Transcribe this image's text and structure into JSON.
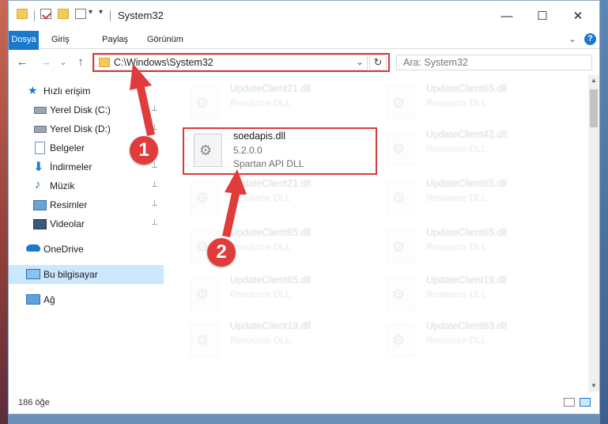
{
  "window": {
    "title": "System32",
    "controls": {
      "minimize": "—",
      "maximize": "☐",
      "close": "✕"
    }
  },
  "ribbon": {
    "tabs": [
      "Dosya",
      "Giriş",
      "Paylaş",
      "Görünüm"
    ],
    "help_icon": "?",
    "expand_icon": "⌄"
  },
  "nav": {
    "back": "←",
    "forward": "→",
    "recent": "⌄",
    "up": "↑",
    "address": "C:\\Windows\\System32",
    "address_dropdown": "⌄",
    "refresh": "↻",
    "search_placeholder": "Ara: System32"
  },
  "sidebar": {
    "items": [
      {
        "label": "Hızlı erişim",
        "icon": "star-icon",
        "pinned": false
      },
      {
        "label": "Yerel Disk (C:)",
        "icon": "drive-icon",
        "pinned": true
      },
      {
        "label": "Yerel Disk (D:)",
        "icon": "drive-icon",
        "pinned": true
      },
      {
        "label": "Belgeler",
        "icon": "document-icon",
        "pinned": true
      },
      {
        "label": "İndirmeler",
        "icon": "download-icon",
        "pinned": true
      },
      {
        "label": "Müzik",
        "icon": "music-icon",
        "pinned": true
      },
      {
        "label": "Resimler",
        "icon": "picture-icon",
        "pinned": true
      },
      {
        "label": "Videolar",
        "icon": "video-icon",
        "pinned": true
      },
      {
        "label": "OneDrive",
        "icon": "cloud-icon",
        "pinned": false
      },
      {
        "label": "Bu bilgisayar",
        "icon": "computer-icon",
        "pinned": false
      },
      {
        "label": "Ağ",
        "icon": "network-icon",
        "pinned": false
      }
    ],
    "pin_glyph": "📌"
  },
  "files": {
    "highlighted": {
      "name": "soedapis.dll",
      "version": "5.2.0.0",
      "description": "Spartan API DLL"
    },
    "background": [
      {
        "name": "UpdateClient21.dll",
        "desc": "Resource DLL"
      },
      {
        "name": "UpdateClient65.dll",
        "desc": "Resource DLL"
      },
      {
        "name": "UpdateClient42.dll",
        "desc": "Resource DLL"
      },
      {
        "name": "UpdateClient21.dll",
        "desc": "Resource DLL"
      },
      {
        "name": "UpdateClient65.dll",
        "desc": "Resource DLL"
      },
      {
        "name": "UpdateClient65.dll",
        "desc": "Resource DLL"
      },
      {
        "name": "UpdateClient65.dll",
        "desc": "Resource DLL"
      },
      {
        "name": "UpdateClient65.dll",
        "desc": "Resource DLL"
      },
      {
        "name": "UpdateClient19.dll",
        "desc": "Resource DLL"
      },
      {
        "name": "UpdateClient19.dll",
        "desc": "Resource DLL"
      },
      {
        "name": "UpdateClient63.dll",
        "desc": "Resource DLL"
      }
    ]
  },
  "status": {
    "count": "186 öğe"
  },
  "annotations": {
    "badge1": "1",
    "badge2": "2"
  },
  "colors": {
    "accent": "#1979ca",
    "highlight": "#d83a3a",
    "selected": "#cce8ff"
  }
}
